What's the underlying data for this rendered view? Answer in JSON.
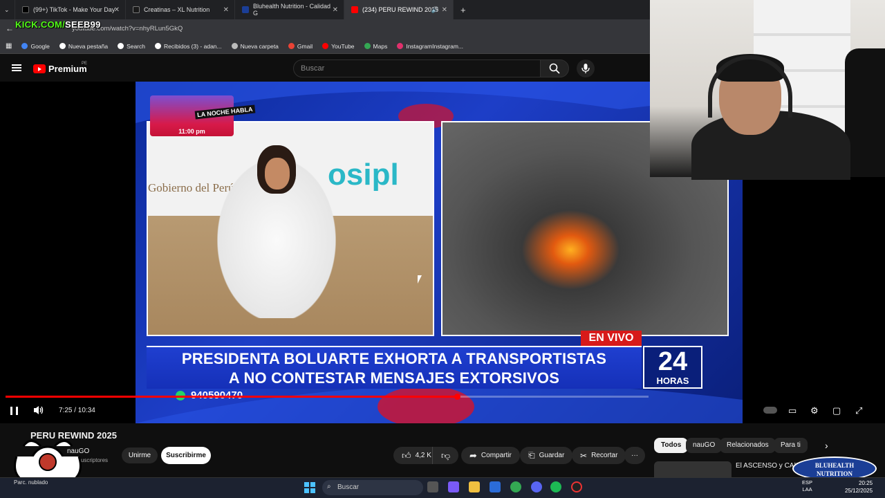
{
  "browser": {
    "tabs": [
      {
        "label": "(99+) TikTok - Make Your Day",
        "color": "#000000"
      },
      {
        "label": "Creatinas – XL Nutrition",
        "color": "#1a1a1a"
      },
      {
        "label": "Bluhealth Nutrition - Calidad G",
        "color": "#1b3e96"
      },
      {
        "label": "(234) PERU REWIND 2025",
        "color": "#ff0000"
      }
    ],
    "new_tab": "+",
    "url": "youtube.com/watch?v=nhyRLun5GkQ",
    "overlay": {
      "kick_a": "KICK.COM/",
      "kick_b": "SEEB99"
    },
    "bookmarks": [
      {
        "label": "Google",
        "color": "#4285f4"
      },
      {
        "label": "Nueva pestaña",
        "color": "#ffffff"
      },
      {
        "label": "Search",
        "color": "#ffffff"
      },
      {
        "label": "Recibidos (3) - adan...",
        "color": "#ffffff"
      },
      {
        "label": "Nueva carpeta",
        "color": "#bbbbbb"
      },
      {
        "label": "Gmail",
        "color": "#ea4335"
      },
      {
        "label": "YouTube",
        "color": "#ff0000"
      },
      {
        "label": "Maps",
        "color": "#34a853"
      },
      {
        "label": "InstagramInstagram...",
        "color": "#e1306c"
      }
    ]
  },
  "youtube": {
    "logo": "Premium",
    "region": "PE",
    "search_placeholder": "Buscar"
  },
  "broadcast": {
    "show_name": "LA NOCHE HABLA",
    "show_time": "11:00 pm",
    "sign_left": "Gobierno del Perú",
    "sign_right": "osipl",
    "live": "EN VIVO",
    "headline_1": "PRESIDENTA BOLUARTE EXHORTA A TRANSPORTISTAS",
    "headline_2": "A NO CONTESTAR MENSAJES EXTORSIVOS",
    "channel_number": "24",
    "channel_word": "HORAS",
    "phone": "940590470"
  },
  "player": {
    "current_time": "7:25",
    "duration": "10:34",
    "time_display": "7:25 / 10:34",
    "progress": 0.702,
    "buffered": 1.0
  },
  "video": {
    "title": "PERU REWIND 2025",
    "channel": "nauGO",
    "subscribers": "9,9 K suscriptores",
    "join": "Unirme",
    "subscribe": "Suscribirme",
    "likes": "4,2 K",
    "share": "Compartir",
    "save": "Guardar",
    "clip": "Recortar",
    "more": "···"
  },
  "sidebar": {
    "chips": [
      "Todos",
      "nauGO",
      "Relacionados",
      "Para ti"
    ],
    "rec_title": "El ASCENSO y CAÍDA de MCMAHON | Soy Edu"
  },
  "sponsor": {
    "line1": "BLUHEALTH",
    "line2": "NUTRITION"
  },
  "taskbar": {
    "search": "Buscar",
    "lang_1": "ESP",
    "lang_2": "LAA",
    "time": "20:25",
    "date": "25/12/2025",
    "weather": "Parc. nublado"
  }
}
